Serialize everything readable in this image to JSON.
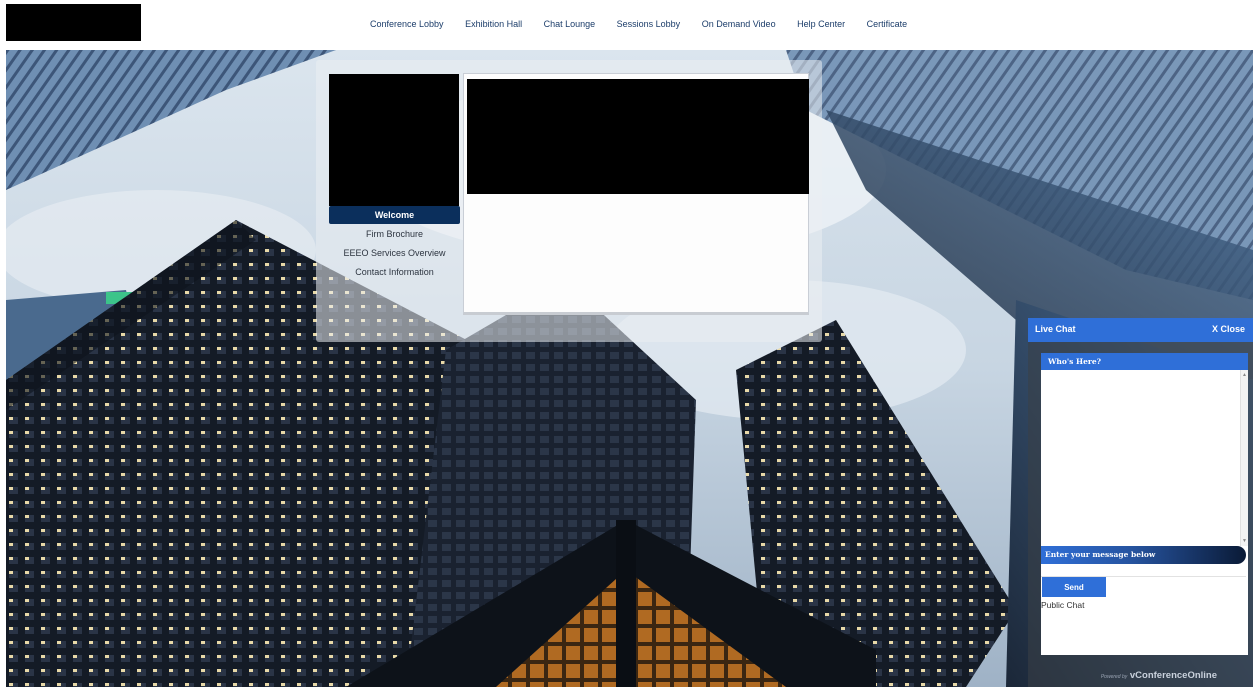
{
  "nav": {
    "items": [
      "Conference Lobby",
      "Exhibition Hall",
      "Chat Lounge",
      "Sessions Lobby",
      "On Demand Video",
      "Help Center",
      "Certificate"
    ]
  },
  "sidebar_menu": {
    "items": [
      "Welcome",
      "Firm Brochure",
      "EEEO Services Overview",
      "Contact Information"
    ],
    "active_index": 0
  },
  "chat": {
    "title": "Live Chat",
    "close_label": "X Close",
    "whos_here": "Who's Here?",
    "message_prompt": "Enter your message below",
    "input_value": "",
    "send_label": "Send",
    "channel_label": "Public Chat",
    "powered_prefix": "Powered by",
    "powered_brand": "vConferenceOnline"
  },
  "colors": {
    "nav_link": "#1c3d6a",
    "menu_active": "#0b2f5c",
    "chat_accent": "#2f6fd8"
  },
  "icons": {
    "scroll_up": "scroll-up-arrow-icon",
    "scroll_down": "scroll-down-arrow-icon"
  }
}
